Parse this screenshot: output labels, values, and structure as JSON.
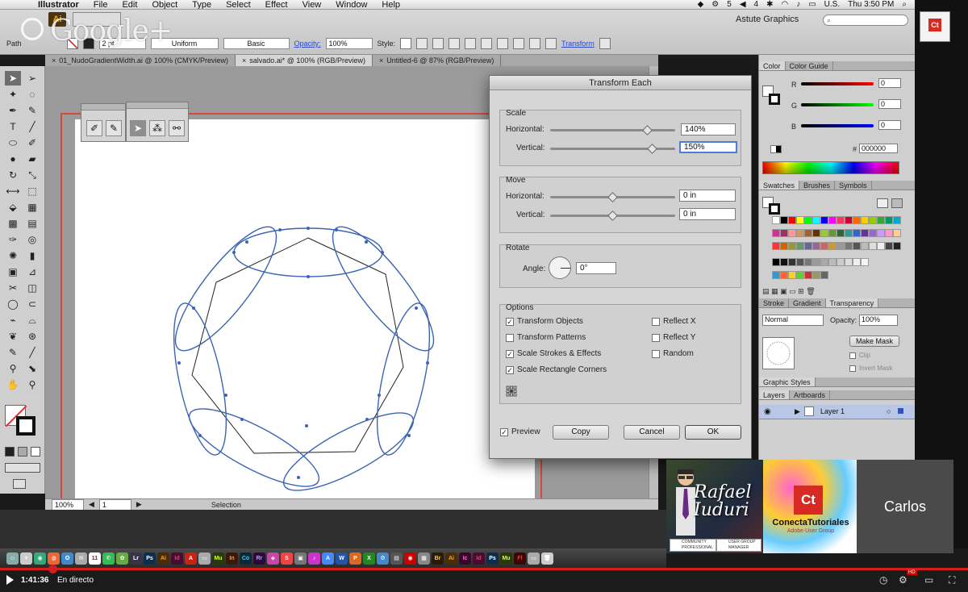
{
  "menubar": {
    "apple_glyph": "",
    "app_name": "Illustrator",
    "items": [
      "File",
      "Edit",
      "Object",
      "Type",
      "Select",
      "Effect",
      "View",
      "Window",
      "Help"
    ],
    "status_5": "5",
    "status_4": "4",
    "locale": "U.S.",
    "clock": "Thu 3:50 PM"
  },
  "controlbar": {
    "app_icon": "Ai",
    "workspace": "Astute Graphics",
    "object_type": "Path",
    "stroke_weight": "2 pt",
    "profile": "Uniform",
    "brush": "Basic",
    "opacity_label": "Opacity:",
    "opacity_value": "100%",
    "style_label": "Style:",
    "transform_label": "Transform"
  },
  "overlay": {
    "gplus": "Google+"
  },
  "doctabs": [
    "01_NudoGradientWidth.ai @ 100% (CMYK/Preview)",
    "salvado.ai* @ 100% (RGB/Preview)",
    "Untitled-6 @ 87% (RGB/Preview)"
  ],
  "statusbar": {
    "zoom": "100%",
    "artboard": "1",
    "tool": "Selection"
  },
  "dialog": {
    "title": "Transform Each",
    "scale": {
      "title": "Scale",
      "horizontal_label": "Horizontal:",
      "horizontal_value": "140%",
      "horizontal_pos": 0.78,
      "vertical_label": "Vertical:",
      "vertical_value": "150%",
      "vertical_pos": 0.82
    },
    "move": {
      "title": "Move",
      "horizontal_label": "Horizontal:",
      "horizontal_value": "0 in",
      "horizontal_pos": 0.5,
      "vertical_label": "Vertical:",
      "vertical_value": "0 in",
      "vertical_pos": 0.5
    },
    "rotate": {
      "title": "Rotate",
      "angle_label": "Angle:",
      "angle_value": "0°"
    },
    "options": {
      "title": "Options",
      "transform_objects": "Transform Objects",
      "transform_patterns": "Transform Patterns",
      "scale_strokes": "Scale Strokes & Effects",
      "scale_corners": "Scale Rectangle Corners",
      "reflect_x": "Reflect X",
      "reflect_y": "Reflect Y",
      "random": "Random"
    },
    "preview_label": "Preview",
    "copy_label": "Copy",
    "cancel_label": "Cancel",
    "ok_label": "OK"
  },
  "color_panel": {
    "tab_color": "Color",
    "tab_guide": "Color Guide",
    "r_label": "R",
    "g_label": "G",
    "b_label": "B",
    "r_value": "0",
    "g_value": "0",
    "b_value": "0",
    "hex_label": "#",
    "hex_value": "000000"
  },
  "swatches_panel": {
    "tab_swatches": "Swatches",
    "tab_brushes": "Brushes",
    "tab_symbols": "Symbols"
  },
  "transparency_panel": {
    "tab_stroke": "Stroke",
    "tab_gradient": "Gradient",
    "tab_transparency": "Transparency",
    "blend_mode": "Normal",
    "opacity_label": "Opacity:",
    "opacity_value": "100%",
    "make_mask": "Make Mask",
    "clip": "Clip",
    "invert_mask": "Invert Mask"
  },
  "graphic_styles": {
    "title": "Graphic Styles"
  },
  "layers_panel": {
    "tab_layers": "Layers",
    "tab_artboards": "Artboards",
    "layer_name": "Layer 1"
  },
  "video": {
    "presenter_name": "Rafael Iuduri",
    "badge1": "COMMUNITY PROFESSIONAL",
    "badge2": "USER GROUP MANAGER",
    "ct_badge": "Ct",
    "ct_name": "ConectaTutoriales",
    "ct_sub": "Adobe User Group",
    "participant": "Carlos"
  },
  "dock": [
    "Lr",
    "Ps",
    "Ai",
    "Id",
    "Mu",
    "In",
    "Co",
    "Rr",
    "Br",
    "Ai",
    "Ic",
    "Id",
    "Ps",
    "Mu",
    "Fl"
  ],
  "youtube": {
    "time": "1:41:36",
    "live": "En directo",
    "hd": "HD"
  }
}
